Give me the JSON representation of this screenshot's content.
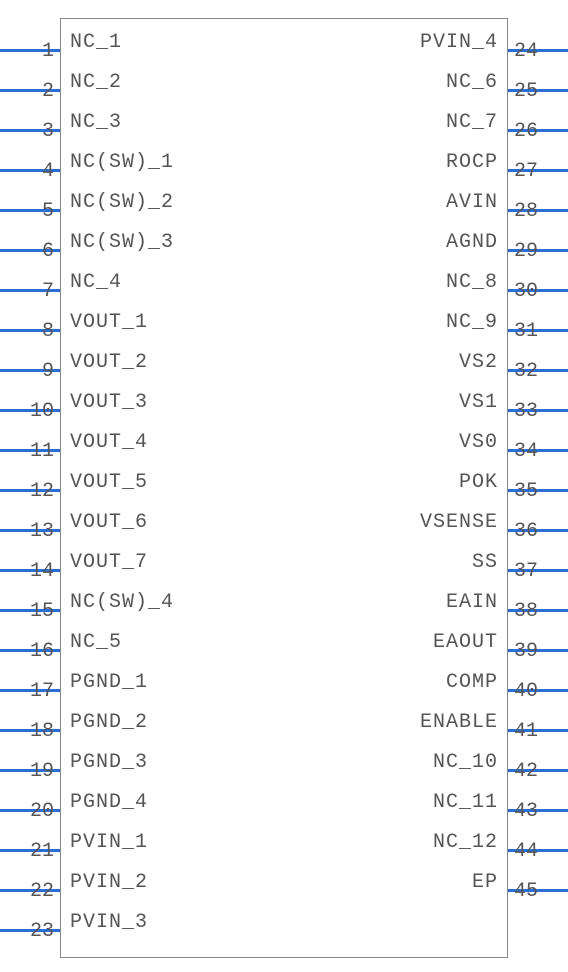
{
  "left_pins": [
    {
      "num": "1",
      "label": "NC_1"
    },
    {
      "num": "2",
      "label": "NC_2"
    },
    {
      "num": "3",
      "label": "NC_3"
    },
    {
      "num": "4",
      "label": "NC(SW)_1"
    },
    {
      "num": "5",
      "label": "NC(SW)_2"
    },
    {
      "num": "6",
      "label": "NC(SW)_3"
    },
    {
      "num": "7",
      "label": "NC_4"
    },
    {
      "num": "8",
      "label": "VOUT_1"
    },
    {
      "num": "9",
      "label": "VOUT_2"
    },
    {
      "num": "10",
      "label": "VOUT_3"
    },
    {
      "num": "11",
      "label": "VOUT_4"
    },
    {
      "num": "12",
      "label": "VOUT_5"
    },
    {
      "num": "13",
      "label": "VOUT_6"
    },
    {
      "num": "14",
      "label": "VOUT_7"
    },
    {
      "num": "15",
      "label": "NC(SW)_4"
    },
    {
      "num": "16",
      "label": "NC_5"
    },
    {
      "num": "17",
      "label": "PGND_1"
    },
    {
      "num": "18",
      "label": "PGND_2"
    },
    {
      "num": "19",
      "label": "PGND_3"
    },
    {
      "num": "20",
      "label": "PGND_4"
    },
    {
      "num": "21",
      "label": "PVIN_1"
    },
    {
      "num": "22",
      "label": "PVIN_2"
    },
    {
      "num": "23",
      "label": "PVIN_3"
    }
  ],
  "right_pins": [
    {
      "num": "24",
      "label": "PVIN_4"
    },
    {
      "num": "25",
      "label": "NC_6"
    },
    {
      "num": "26",
      "label": "NC_7"
    },
    {
      "num": "27",
      "label": "ROCP"
    },
    {
      "num": "28",
      "label": "AVIN"
    },
    {
      "num": "29",
      "label": "AGND"
    },
    {
      "num": "30",
      "label": "NC_8"
    },
    {
      "num": "31",
      "label": "NC_9"
    },
    {
      "num": "32",
      "label": "VS2"
    },
    {
      "num": "33",
      "label": "VS1"
    },
    {
      "num": "34",
      "label": "VS0"
    },
    {
      "num": "35",
      "label": "POK"
    },
    {
      "num": "36",
      "label": "VSENSE"
    },
    {
      "num": "37",
      "label": "SS"
    },
    {
      "num": "38",
      "label": "EAIN"
    },
    {
      "num": "39",
      "label": "EAOUT"
    },
    {
      "num": "40",
      "label": "COMP"
    },
    {
      "num": "41",
      "label": "ENABLE"
    },
    {
      "num": "42",
      "label": "NC_10"
    },
    {
      "num": "43",
      "label": "NC_11"
    },
    {
      "num": "44",
      "label": "NC_12"
    },
    {
      "num": "45",
      "label": "EP"
    }
  ],
  "layout": {
    "left_start": 22,
    "left_step": 40,
    "right_start": 22,
    "right_step": 40
  }
}
